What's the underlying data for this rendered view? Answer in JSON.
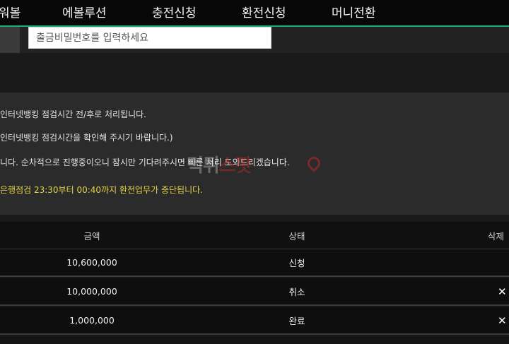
{
  "nav": {
    "items": [
      {
        "label": "워볼"
      },
      {
        "label": "에볼루션"
      },
      {
        "label": "충전신청"
      },
      {
        "label": "환전신청"
      },
      {
        "label": "머니전환"
      }
    ]
  },
  "withdraw_form": {
    "password_placeholder": "출금비밀번호를 입력하세요"
  },
  "notices": [
    {
      "text": "인터넷뱅킹 점검시간 전/후로 처리됩니다."
    },
    {
      "text": "인터넷뱅킹 점검시간을 확인해 주시기 바랍니다.)"
    },
    {
      "text": "니다. 순차적으로 진행중이오니 잠시만 기다려주시면 빠른 처리 도와드리겠습니다."
    },
    {
      "text": "은행점검 23:30부터 00:40까지 환전업무가 중단됩니다."
    }
  ],
  "watermark": {
    "main": "먹튀",
    "accent": "스팟"
  },
  "table": {
    "headers": {
      "amount": "금액",
      "status": "상태",
      "delete": "삭제"
    },
    "rows": [
      {
        "amount": "10,600,000",
        "status": "신청",
        "delete": ""
      },
      {
        "amount": "10,000,000",
        "status": "취소",
        "delete": "✕"
      },
      {
        "amount": "1,000,000",
        "status": "완료",
        "delete": "✕"
      }
    ]
  },
  "colors": {
    "accent": "#19ae7c",
    "notice_warning": "#e5d24a"
  }
}
